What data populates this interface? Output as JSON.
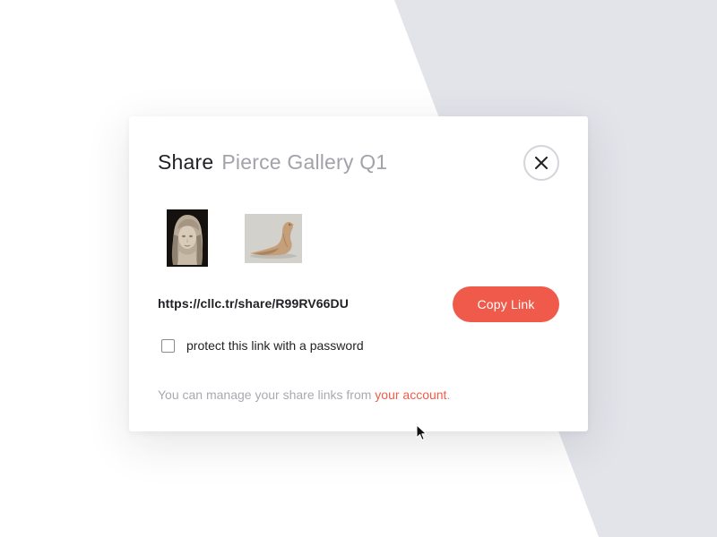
{
  "colors": {
    "accent": "#f05a4b",
    "background_shape": "#e3e3ea",
    "title": "#222226",
    "subtitle": "#a2a2ab",
    "muted_text": "#a9a9b0"
  },
  "dialog": {
    "title": "Share",
    "subtitle": "Pierce Gallery Q1",
    "close_icon": "close-icon",
    "thumbnails": [
      {
        "name": "marble-child-bust-sculpture"
      },
      {
        "name": "ceramic-bird-figurine"
      }
    ],
    "share_url": "https://cllc.tr/share/R99RV66DU",
    "copy_button_label": "Copy Link",
    "password_checkbox": {
      "label": "protect this link with a password",
      "checked": false
    },
    "footer": {
      "text_before": "You can manage your share links from ",
      "link_text": "your account",
      "text_after": "."
    }
  },
  "cursor_icon": "arrow-cursor-icon"
}
